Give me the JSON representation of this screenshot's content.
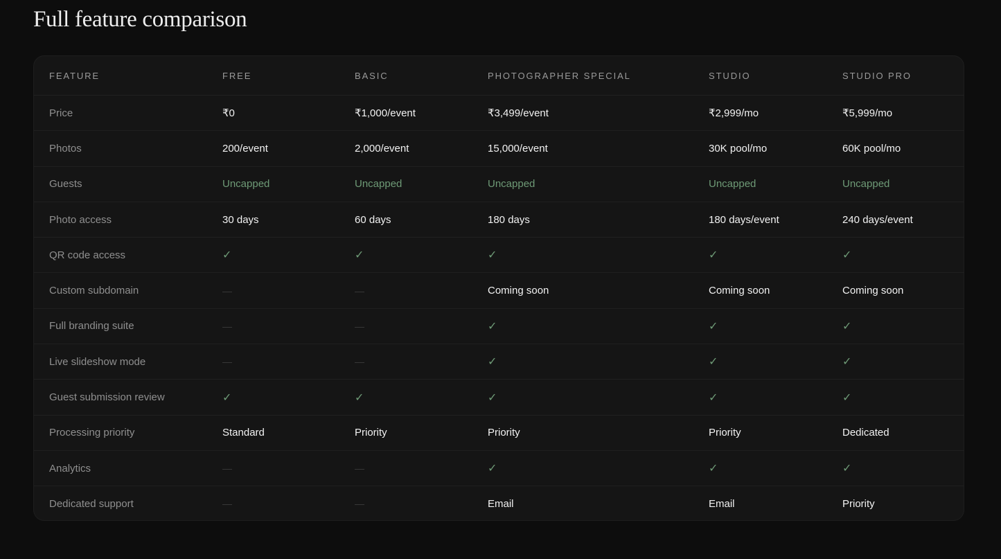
{
  "page": {
    "title": "Full feature comparison"
  },
  "table": {
    "columns": [
      "FEATURE",
      "FREE",
      "BASIC",
      "PHOTOGRAPHER SPECIAL",
      "STUDIO",
      "STUDIO PRO"
    ],
    "rows": [
      {
        "label": "Price",
        "cells": [
          "₹0",
          "₹1,000/event",
          "₹3,499/event",
          "₹2,999/mo",
          "₹5,999/mo"
        ]
      },
      {
        "label": "Photos",
        "cells": [
          "200/event",
          "2,000/event",
          "15,000/event",
          "30K pool/mo",
          "60K pool/mo"
        ]
      },
      {
        "label": "Guests",
        "cells": [
          "Uncapped",
          "Uncapped",
          "Uncapped",
          "Uncapped",
          "Uncapped"
        ]
      },
      {
        "label": "Photo access",
        "cells": [
          "30 days",
          "60 days",
          "180 days",
          "180 days/event",
          "240 days/event"
        ]
      },
      {
        "label": "QR code access",
        "cells": [
          "✓",
          "✓",
          "✓",
          "✓",
          "✓"
        ]
      },
      {
        "label": "Custom subdomain",
        "cells": [
          "—",
          "—",
          "Coming soon",
          "Coming soon",
          "Coming soon"
        ]
      },
      {
        "label": "Full branding suite",
        "cells": [
          "—",
          "—",
          "✓",
          "✓",
          "✓"
        ]
      },
      {
        "label": "Live slideshow mode",
        "cells": [
          "—",
          "—",
          "✓",
          "✓",
          "✓"
        ]
      },
      {
        "label": "Guest submission review",
        "cells": [
          "✓",
          "✓",
          "✓",
          "✓",
          "✓"
        ]
      },
      {
        "label": "Processing priority",
        "cells": [
          "Standard",
          "Priority",
          "Priority",
          "Priority",
          "Dedicated"
        ]
      },
      {
        "label": "Analytics",
        "cells": [
          "—",
          "—",
          "✓",
          "✓",
          "✓"
        ]
      },
      {
        "label": "Dedicated support",
        "cells": [
          "—",
          "—",
          "Email",
          "Email",
          "Priority"
        ]
      }
    ]
  },
  "colors": {
    "background": "#0d0d0d",
    "card": "#151515",
    "accent_green": "#6e9a76",
    "muted_label": "#8f8f8f"
  }
}
